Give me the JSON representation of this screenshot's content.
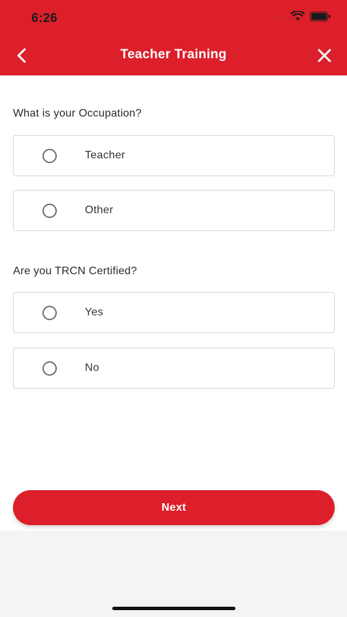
{
  "status_bar": {
    "time": "6:26"
  },
  "header": {
    "title": "Teacher Training"
  },
  "questions": [
    {
      "text": "What is your Occupation?",
      "options": [
        {
          "label": "Teacher"
        },
        {
          "label": "Other"
        }
      ]
    },
    {
      "text": "Are you TRCN Certified?",
      "options": [
        {
          "label": "Yes"
        },
        {
          "label": "No"
        }
      ]
    }
  ],
  "footer": {
    "next_label": "Next"
  },
  "colors": {
    "brand": "#dc1f2a",
    "background": "#ffffff",
    "footer_background": "#f4f4f4"
  },
  "icons": {
    "back": "chevron-left-icon",
    "close": "close-icon",
    "wifi": "wifi-icon",
    "battery": "battery-icon",
    "radio": "radio-unselected-icon"
  }
}
